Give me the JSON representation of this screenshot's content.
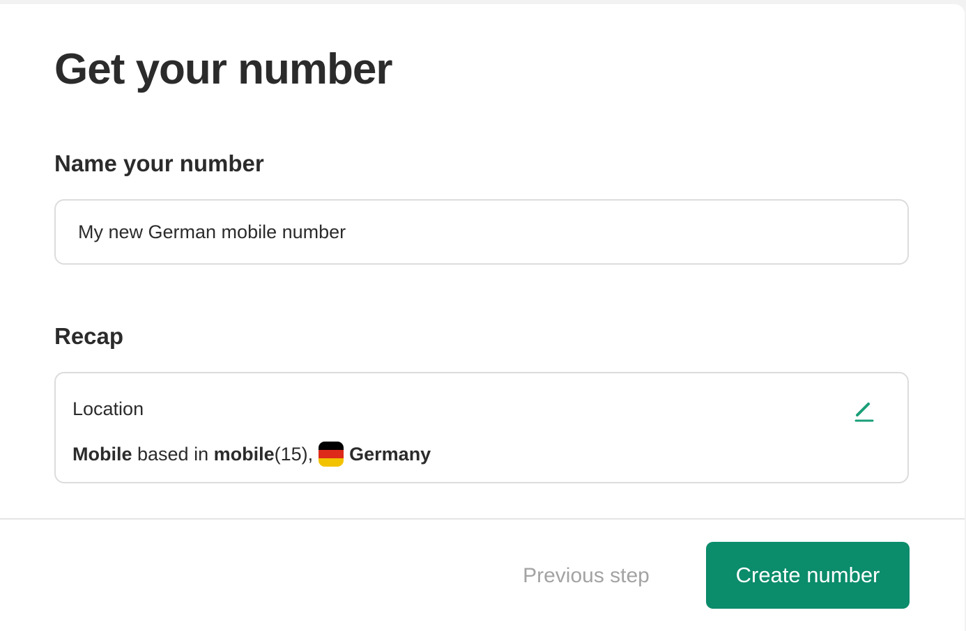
{
  "page": {
    "title": "Get your number"
  },
  "name_section": {
    "heading": "Name your number",
    "input_value": "My new German mobile number"
  },
  "recap_section": {
    "heading": "Recap",
    "location_label": "Location",
    "line_type": "Mobile",
    "line_based_in": " based in ",
    "line_prefix_name": "mobile",
    "line_prefix_code": "(15),",
    "line_country": "Germany",
    "flag_icon": "germany-flag-icon",
    "edit_icon": "pencil-icon"
  },
  "footer": {
    "previous_label": "Previous step",
    "create_label": "Create number"
  },
  "colors": {
    "accent": "#0b8c6b",
    "edit_icon": "#1a9e78",
    "disabled_text": "#a3a3a3",
    "border": "#dcdcdc"
  }
}
